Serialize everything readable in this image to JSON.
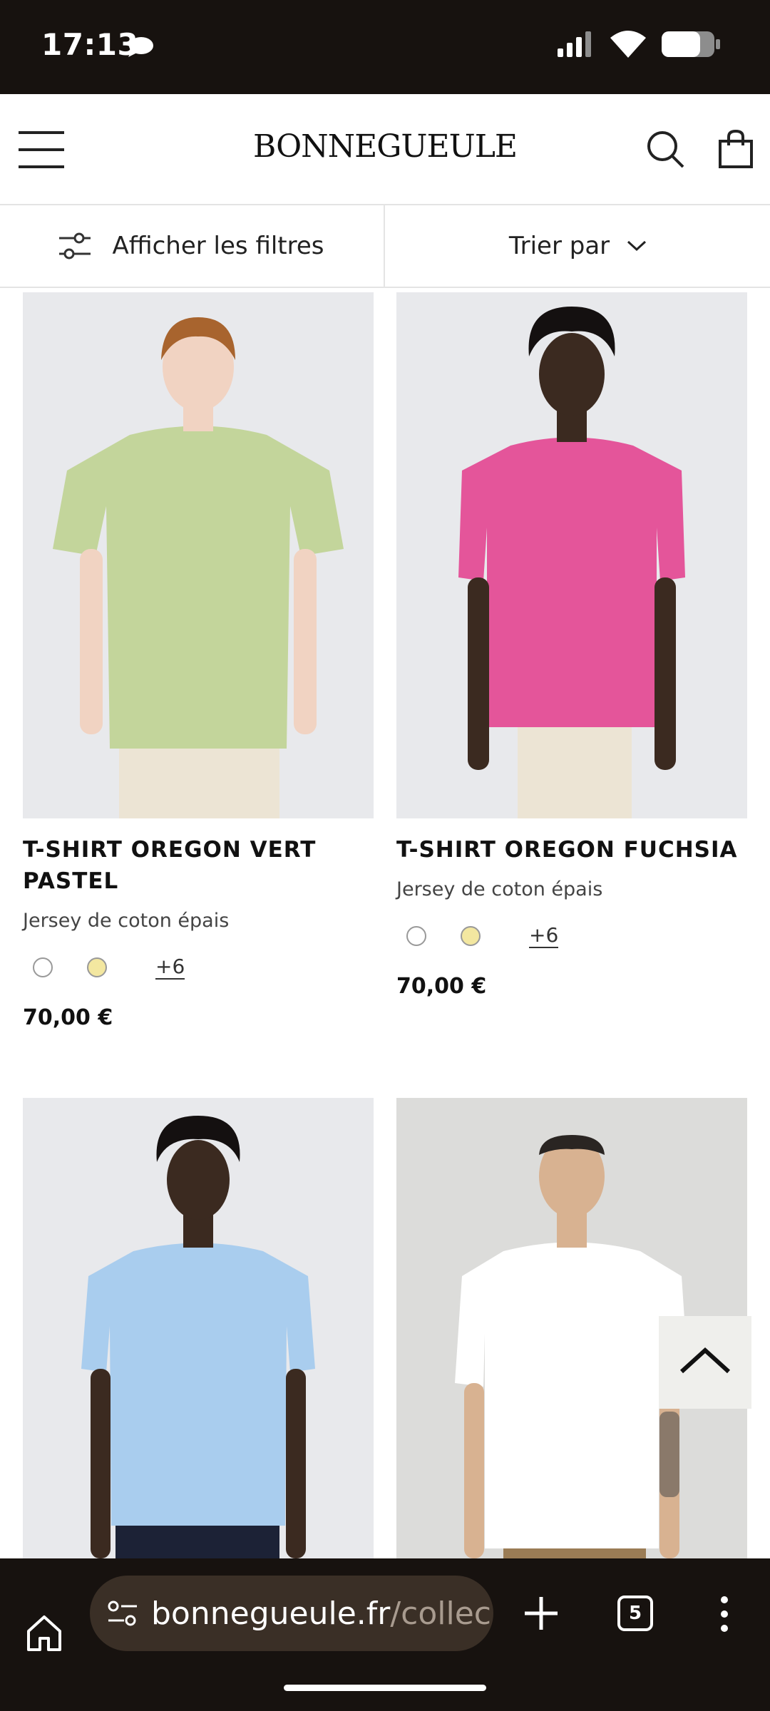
{
  "status_bar": {
    "time": "17:13"
  },
  "header": {
    "brand": "BONNEGUEULE"
  },
  "filters": {
    "show_filters_label": "Afficher les filtres",
    "sort_label": "Trier par"
  },
  "products": [
    {
      "name": "T-SHIRT OREGON VERT PASTEL",
      "subtitle": "Jersey de coton épais",
      "more_colors": "+6",
      "price": "70,00 €",
      "shirt_color": "#c3d59b",
      "swatches": [
        "#ffffff",
        "#f3e7a0"
      ]
    },
    {
      "name": "T-SHIRT OREGON FUCHSIA",
      "subtitle": "Jersey de coton épais",
      "more_colors": "+6",
      "price": "70,00 €",
      "shirt_color": "#e4559a",
      "swatches": [
        "#ffffff",
        "#f3e7a0"
      ]
    },
    {
      "shirt_color": "#a9cdee"
    },
    {
      "shirt_color": "#ffffff"
    }
  ],
  "browser": {
    "url_domain": "bonnegueule.fr",
    "url_path": "/collec",
    "tab_count": "5"
  },
  "colors": {
    "system_bar": "#17120f",
    "url_pill": "#3a2f26",
    "image_bg": "#e8e9ec"
  },
  "icons": [
    "chat-bubble-icon",
    "signal-icon",
    "wifi-icon",
    "battery-icon",
    "menu-icon",
    "search-icon",
    "cart-icon",
    "filter-sliders-icon",
    "chevron-down-icon",
    "chevron-up-icon",
    "home-icon",
    "site-settings-icon",
    "plus-icon",
    "tabs-icon",
    "more-vert-icon"
  ]
}
